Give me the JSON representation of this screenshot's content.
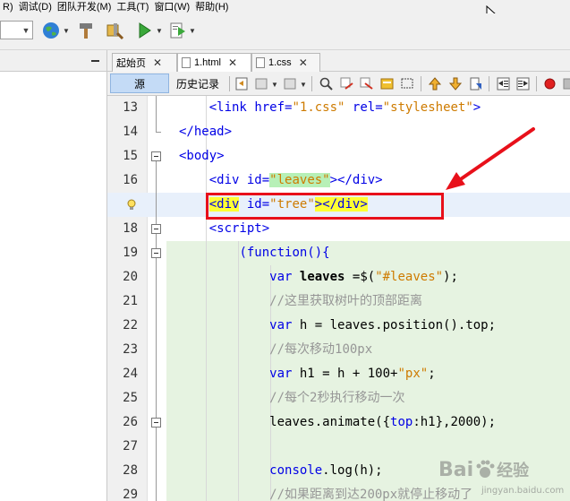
{
  "menu": {
    "items": [
      "R)",
      "调试(D)",
      "团队开发(M)",
      "工具(T)",
      "窗口(W)",
      "帮助(H)"
    ]
  },
  "toolbar": {
    "icons": [
      "globe-icon",
      "hammer-icon",
      "clean-build-icon",
      "run-icon",
      "debug-icon"
    ]
  },
  "tabs": [
    {
      "label": "起始页",
      "active": false
    },
    {
      "label": "1.html",
      "active": true
    },
    {
      "label": "1.css",
      "active": false
    }
  ],
  "editor_toolbar": {
    "source_label": "源",
    "history_label": "历史记录"
  },
  "code_lines": [
    {
      "n": "13",
      "segments": [
        {
          "t": "    ",
          "c": ""
        },
        {
          "t": "<link",
          "c": "tag"
        },
        {
          "t": " ",
          "c": ""
        },
        {
          "t": "href=",
          "c": "attr"
        },
        {
          "t": "\"1.css\"",
          "c": "str"
        },
        {
          "t": " ",
          "c": ""
        },
        {
          "t": "rel=",
          "c": "attr"
        },
        {
          "t": "\"stylesheet\"",
          "c": "str"
        },
        {
          "t": ">",
          "c": "tag"
        }
      ]
    },
    {
      "n": "14",
      "segments": [
        {
          "t": "</head>",
          "c": "tag"
        }
      ]
    },
    {
      "n": "15",
      "segments": [
        {
          "t": "<body>",
          "c": "tag"
        }
      ]
    },
    {
      "n": "16",
      "segments": [
        {
          "t": "    ",
          "c": ""
        },
        {
          "t": "<div",
          "c": "tag"
        },
        {
          "t": " ",
          "c": ""
        },
        {
          "t": "id=",
          "c": "attr"
        },
        {
          "t": "\"leaves\"",
          "c": "str hlg"
        },
        {
          "t": "></div>",
          "c": "tag"
        }
      ]
    },
    {
      "n": "",
      "segments": [
        {
          "t": "    ",
          "c": ""
        },
        {
          "t": "<div",
          "c": "tag hl"
        },
        {
          "t": " ",
          "c": ""
        },
        {
          "t": "id=",
          "c": "attr"
        },
        {
          "t": "\"tree\"",
          "c": "str"
        },
        {
          "t": ">",
          "c": "tag hl"
        },
        {
          "t": "</div>",
          "c": "tag hl"
        }
      ]
    },
    {
      "n": "18",
      "segments": [
        {
          "t": "    ",
          "c": ""
        },
        {
          "t": "<script>",
          "c": "tag"
        }
      ]
    },
    {
      "n": "19",
      "segments": [
        {
          "t": "        ",
          "c": ""
        },
        {
          "t": "(function(){",
          "c": "kw"
        }
      ]
    },
    {
      "n": "20",
      "segments": [
        {
          "t": "            ",
          "c": ""
        },
        {
          "t": "var",
          "c": "kw"
        },
        {
          "t": " ",
          "c": ""
        },
        {
          "t": "leaves",
          "c": "bold"
        },
        {
          "t": " =$(",
          "c": ""
        },
        {
          "t": "\"#leaves\"",
          "c": "str"
        },
        {
          "t": ");",
          "c": ""
        }
      ]
    },
    {
      "n": "21",
      "segments": [
        {
          "t": "            ",
          "c": ""
        },
        {
          "t": "//这里获取树叶的顶部距离",
          "c": "cm"
        }
      ]
    },
    {
      "n": "22",
      "segments": [
        {
          "t": "            ",
          "c": ""
        },
        {
          "t": "var",
          "c": "kw"
        },
        {
          "t": " h = leaves.position().top;",
          "c": ""
        }
      ]
    },
    {
      "n": "23",
      "segments": [
        {
          "t": "            ",
          "c": ""
        },
        {
          "t": "//每次移动100px",
          "c": "cm"
        }
      ]
    },
    {
      "n": "24",
      "segments": [
        {
          "t": "            ",
          "c": ""
        },
        {
          "t": "var",
          "c": "kw"
        },
        {
          "t": " h1 = h + 100+",
          "c": ""
        },
        {
          "t": "\"px\"",
          "c": "str"
        },
        {
          "t": ";",
          "c": ""
        }
      ]
    },
    {
      "n": "25",
      "segments": [
        {
          "t": "            ",
          "c": ""
        },
        {
          "t": "//每个2秒执行移动一次",
          "c": "cm"
        }
      ]
    },
    {
      "n": "26",
      "segments": [
        {
          "t": "            ",
          "c": ""
        },
        {
          "t": "leaves.animate({",
          "c": ""
        },
        {
          "t": "top",
          "c": "kw"
        },
        {
          "t": ":h1},2000);",
          "c": ""
        }
      ]
    },
    {
      "n": "27",
      "segments": []
    },
    {
      "n": "28",
      "segments": [
        {
          "t": "            ",
          "c": ""
        },
        {
          "t": "console",
          "c": "kw"
        },
        {
          "t": ".log(h);",
          "c": ""
        }
      ]
    },
    {
      "n": "29",
      "segments": [
        {
          "t": "            ",
          "c": ""
        },
        {
          "t": "//如果距离到达200px就停止移动了",
          "c": "cm"
        }
      ]
    }
  ],
  "watermark": {
    "brand": "Bai",
    "brand2": "经验",
    "sub": "jingyan.baidu.com"
  },
  "colors": {
    "annotation_red": "#e8101a",
    "tag_blue": "#0000e6",
    "string_orange": "#ce7b00",
    "comment_gray": "#969696",
    "highlight_yellow": "#ffff33",
    "block_green": "#e6f3e1"
  }
}
